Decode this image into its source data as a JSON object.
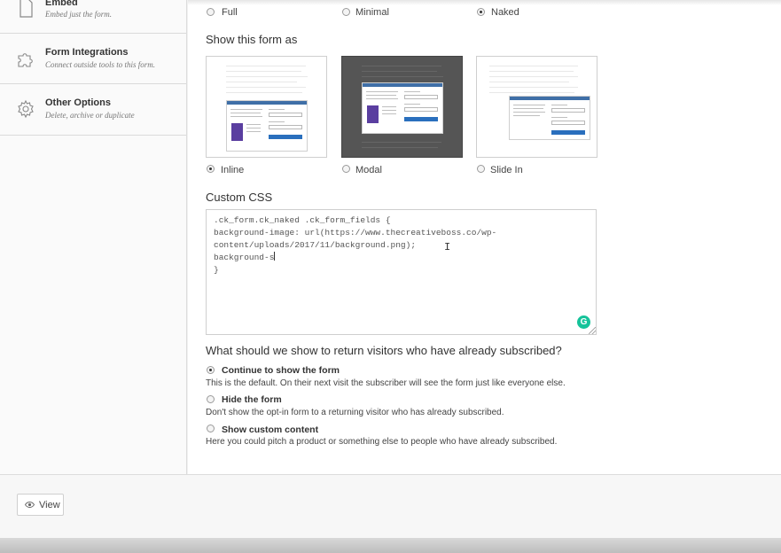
{
  "sidebar": {
    "items": [
      {
        "title": "Embed",
        "desc": "Embed just the form.",
        "icon": "document-icon"
      },
      {
        "title": "Form Integrations",
        "desc": "Connect outside tools to this form.",
        "icon": "puzzle-icon"
      },
      {
        "title": "Other Options",
        "desc": "Delete, archive or duplicate",
        "icon": "gear-icon"
      }
    ]
  },
  "style_options": [
    {
      "label": "Full",
      "checked": false
    },
    {
      "label": "Minimal",
      "checked": false
    },
    {
      "label": "Naked",
      "checked": true
    }
  ],
  "show_as": {
    "heading": "Show this form as",
    "options": [
      {
        "label": "Inline",
        "checked": true
      },
      {
        "label": "Modal",
        "checked": false
      },
      {
        "label": "Slide In",
        "checked": false
      }
    ]
  },
  "custom_css": {
    "heading": "Custom CSS",
    "lines": [
      ".ck_form.ck_naked .ck_form_fields {",
      "background-image: url(https://www.thecreativeboss.co/wp-",
      "content/uploads/2017/11/background.png);",
      "background-s",
      "}"
    ],
    "grammarly_badge": "G"
  },
  "return_visitors": {
    "heading": "What should we show to return visitors who have already subscribed?",
    "options": [
      {
        "title": "Continue to show the form",
        "desc": "This is the default. On their next visit the subscriber will see the form just like everyone else.",
        "checked": true
      },
      {
        "title": "Hide the form",
        "desc": "Don't show the opt-in form to a returning visitor who has already subscribed.",
        "checked": false
      },
      {
        "title": "Show custom content",
        "desc": "Here you could pitch a product or something else to people who have already subscribed.",
        "checked": false
      }
    ]
  },
  "footer": {
    "view_label": "View",
    "view_icon": "eye-icon"
  },
  "colors": {
    "accent_blue": "#3f6fa7",
    "book_purple": "#5a3ea0",
    "grammarly_green": "#15c39a"
  }
}
